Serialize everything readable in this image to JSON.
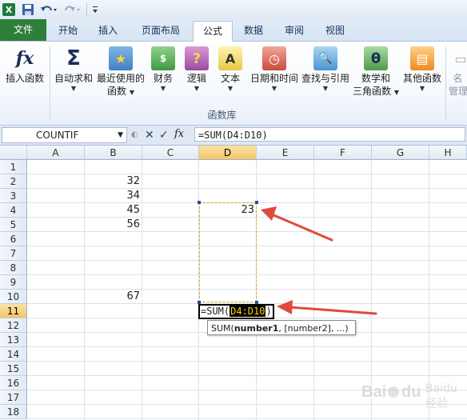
{
  "quick_access": {
    "app_icon": "excel-icon",
    "save_icon": "save-icon",
    "undo_icon": "undo-icon",
    "redo_icon": "redo-icon",
    "customize_icon": "customize-qat-icon",
    "app_letter": "X"
  },
  "tabs": [
    {
      "label": "文件",
      "key": "file"
    },
    {
      "label": "开始",
      "key": "home"
    },
    {
      "label": "插入",
      "key": "insert"
    },
    {
      "label": "页面布局",
      "key": "page-layout"
    },
    {
      "label": "公式",
      "key": "formulas",
      "active": true
    },
    {
      "label": "数据",
      "key": "data"
    },
    {
      "label": "审阅",
      "key": "review"
    },
    {
      "label": "视图",
      "key": "view"
    }
  ],
  "ribbon": {
    "group_label": "函数库",
    "buttons": [
      {
        "line1": "插入函数",
        "line2": "",
        "icon": "fx"
      },
      {
        "line1": "自动求和",
        "line2": "",
        "icon": "Σ"
      },
      {
        "line1": "最近使用的",
        "line2": "函数",
        "icon": "★"
      },
      {
        "line1": "财务",
        "line2": "",
        "icon": "$"
      },
      {
        "line1": "逻辑",
        "line2": "",
        "icon": "?"
      },
      {
        "line1": "文本",
        "line2": "",
        "icon": "A"
      },
      {
        "line1": "日期和时间",
        "line2": "",
        "icon": "◷"
      },
      {
        "line1": "查找与引用",
        "line2": "",
        "icon": "🔍"
      },
      {
        "line1": "数学和",
        "line2": "三角函数",
        "icon": "θ"
      },
      {
        "line1": "其他函数",
        "line2": "",
        "icon": "▤"
      },
      {
        "line1": "名",
        "line2": "管理",
        "icon": "▭"
      }
    ]
  },
  "formula_bar": {
    "name_box": "COUNTIF",
    "cancel": "✕",
    "enter": "✓",
    "fx": "fx",
    "content": "=SUM(D4:D10)"
  },
  "columns": [
    "A",
    "B",
    "C",
    "D",
    "E",
    "F",
    "G",
    "H"
  ],
  "rows": [
    "1",
    "2",
    "3",
    "4",
    "5",
    "6",
    "7",
    "8",
    "9",
    "10",
    "11",
    "12",
    "13",
    "14",
    "15",
    "16",
    "17",
    "18"
  ],
  "cells": [
    {
      "ref": "B2",
      "value": "32"
    },
    {
      "ref": "B3",
      "value": "34"
    },
    {
      "ref": "B4",
      "value": "45"
    },
    {
      "ref": "B5",
      "value": "56"
    },
    {
      "ref": "B10",
      "value": "67"
    },
    {
      "ref": "D4",
      "value": "23"
    }
  ],
  "editing": {
    "prefix": "=SUM(",
    "range": "D4:D10",
    "suffix": ")"
  },
  "tooltip": {
    "name": "SUM(",
    "arg1": "number1",
    "rest": ", [number2], ...)"
  },
  "colors": {
    "arrow": "#e04a3c",
    "range_border": "#1f4eae",
    "selected_header": "#f4c46a",
    "file_tab": "#2f7f3b"
  },
  "watermark": "Baidu 经验"
}
